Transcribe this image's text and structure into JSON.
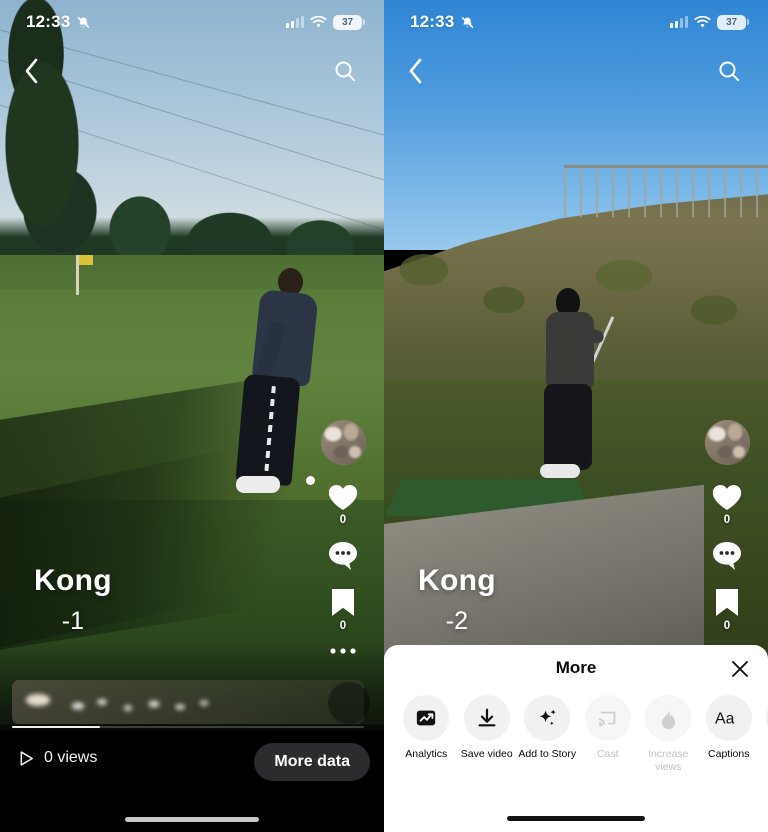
{
  "status_bar": {
    "time": "12:33",
    "mute_icon": "bell-slash-icon",
    "cellular_icon": "cellular-bars-icon",
    "wifi_icon": "wifi-icon",
    "battery_level": "37"
  },
  "nav": {
    "back_icon": "chevron-left-icon",
    "search_icon": "search-icon"
  },
  "left_panel": {
    "overlay": {
      "name": "Kong",
      "score": "-1"
    },
    "rail": {
      "avatar": "profile-avatar",
      "like_icon": "heart-icon",
      "like_count": "0",
      "comment_icon": "comment-bubble-icon",
      "comment_count": "",
      "save_icon": "bookmark-icon",
      "save_count": "0",
      "more_icon": "ellipsis-icon"
    },
    "bottom_bar": {
      "play_icon": "play-triangle-icon",
      "views": "0 views",
      "more_data_label": "More data"
    }
  },
  "right_panel": {
    "overlay": {
      "name": "Kong",
      "score": "-2"
    },
    "rail": {
      "avatar": "profile-avatar",
      "like_icon": "heart-icon",
      "like_count": "0",
      "comment_icon": "comment-bubble-icon",
      "comment_count": "",
      "save_icon": "bookmark-icon",
      "save_count": "0"
    },
    "sheet": {
      "title": "More",
      "close_icon": "close-x-icon",
      "actions": [
        {
          "label": "Analytics",
          "icon": "analytics-chart-icon",
          "enabled": true
        },
        {
          "label": "Save video",
          "icon": "download-icon",
          "enabled": true
        },
        {
          "label": "Add to Story",
          "icon": "sparkle-icon",
          "enabled": true
        },
        {
          "label": "Cast",
          "icon": "cast-icon",
          "enabled": false
        },
        {
          "label": "Increase views",
          "icon": "flame-icon",
          "enabled": false
        },
        {
          "label": "Captions",
          "icon": "text-aa-icon",
          "enabled": true
        }
      ]
    }
  },
  "colors": {
    "sheet_background": "#ffffff",
    "bottom_bar_background": "#000000",
    "more_data_pill": "#2c2c2e",
    "action_circle": "#f1f1f1",
    "disabled_label": "#c3c3c3"
  }
}
